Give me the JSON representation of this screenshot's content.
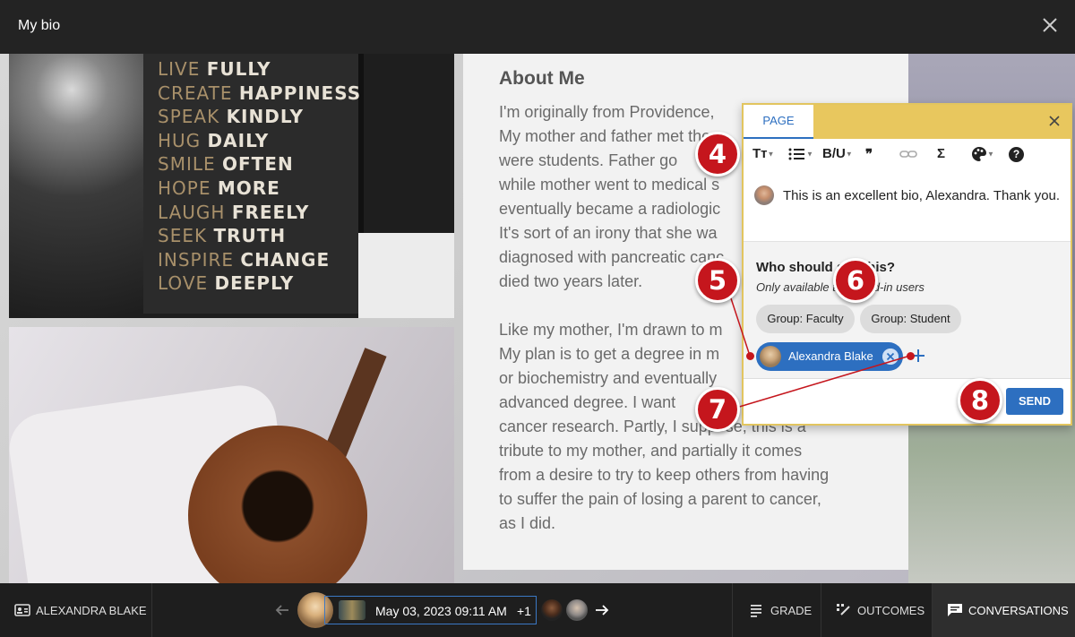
{
  "window": {
    "title": "My bio"
  },
  "book_lines": [
    [
      "LIVE",
      "FULLY"
    ],
    [
      "CREATE",
      "HAPPINESS"
    ],
    [
      "SPEAK",
      "KINDLY"
    ],
    [
      "HUG",
      "DAILY"
    ],
    [
      "SMILE",
      "OFTEN"
    ],
    [
      "HOPE",
      "MORE"
    ],
    [
      "LAUGH",
      "FREELY"
    ],
    [
      "SEEK",
      "TRUTH"
    ],
    [
      "INSPIRE",
      "CHANGE"
    ],
    [
      "LOVE",
      "DEEPLY"
    ]
  ],
  "article": {
    "heading": "About Me",
    "para1": "I'm originally from Providence,\nMy mother and father met the\nwere students. Father go\nwhile mother went to medical s\neventually became a radiologic\nIt's sort of an irony that she wa\ndiagnosed with pancreatic canc\ndied two years later.",
    "para2": "Like my mother, I'm drawn to m\nMy plan is to get a degree in m\nor biochemistry and eventually\nadvanced degree. I want\ncancer research. Partly, I suppose, this is a\ntribute to my mother, and partially it comes\nfrom a desire to try to keep others from having\nto suffer the pain of losing a parent to cancer,\nas I did."
  },
  "popup": {
    "tab_label": "PAGE",
    "toolbar": {
      "text_style": "Tт",
      "bold_underline": "B/U",
      "quote": "❞",
      "sigma": "Σ",
      "help": "?"
    },
    "comment_text": "This is an excellent bio, Alexandra. Thank you.",
    "who_label": "Who should see this?",
    "only_label": "Only available to signed-in users",
    "groups": [
      "Group: Faculty",
      "Group: Student"
    ],
    "recipient": "Alexandra Blake",
    "send_label": "SEND"
  },
  "callouts": [
    "4",
    "5",
    "6",
    "7",
    "8"
  ],
  "bottom": {
    "student_name": "ALEXANDRA BLAKE",
    "submission_date": "May 03, 2023 09:11 AM",
    "extra_count": "+1",
    "grade_label": "GRADE",
    "outcomes_label": "OUTCOMES",
    "conversations_label": "CONVERSATIONS"
  },
  "colors": {
    "accent_blue": "#2d6fc0",
    "callout_red": "#c5161d",
    "popup_yellow": "#e8c75e"
  }
}
